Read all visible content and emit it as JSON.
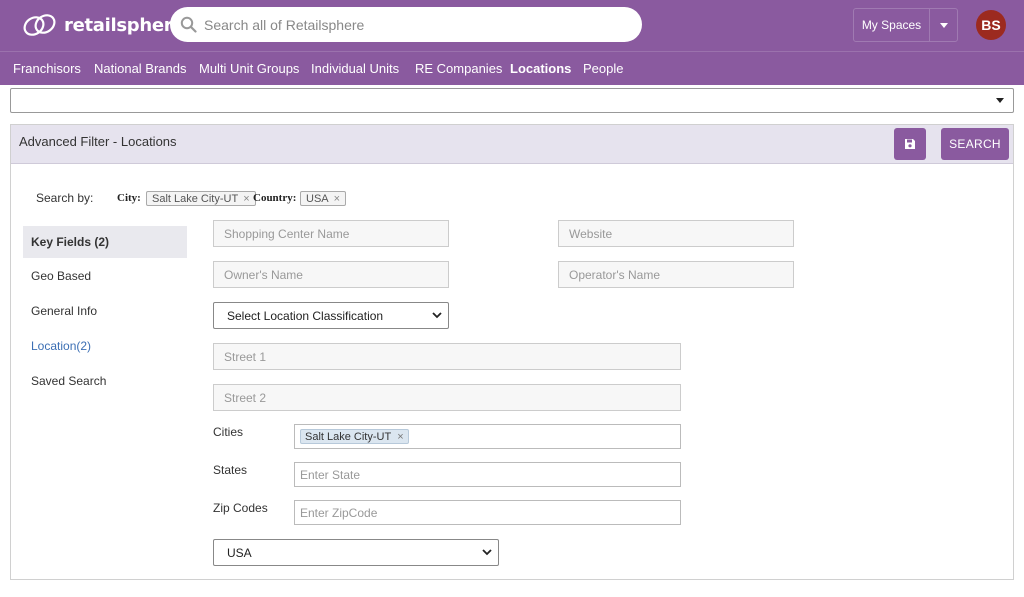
{
  "header": {
    "brand": "retailsphere",
    "search_placeholder": "Search all of Retailsphere",
    "spaces_label": "My Spaces",
    "avatar_initials": "BS",
    "colors": {
      "primary": "#8a5a9f",
      "avatar": "#9c2a1f",
      "link": "#3c6fb4"
    }
  },
  "nav": {
    "items": [
      {
        "label": "Franchisors",
        "active": false
      },
      {
        "label": "National Brands",
        "active": false
      },
      {
        "label": "Multi Unit Groups",
        "active": false
      },
      {
        "label": "Individual Units",
        "active": false
      },
      {
        "label": "RE Companies",
        "active": false
      },
      {
        "label": "Locations",
        "active": true
      },
      {
        "label": "People",
        "active": false
      }
    ]
  },
  "top_select": {
    "value": ""
  },
  "panel": {
    "title": "Advanced Filter - Locations",
    "save_icon": "floppy-disk-icon",
    "search_label": "SEARCH",
    "search_by_label": "Search by:",
    "criteria": [
      {
        "label": "City:",
        "chip": "Salt Lake City-UT"
      },
      {
        "label": "Country:",
        "chip": "USA"
      }
    ]
  },
  "sidebar": {
    "items": [
      {
        "label": "Key Fields (2)",
        "state": "active"
      },
      {
        "label": "Geo Based",
        "state": "normal"
      },
      {
        "label": "General Info",
        "state": "normal"
      },
      {
        "label": "Location(2)",
        "state": "link"
      },
      {
        "label": "Saved Search",
        "state": "normal"
      }
    ]
  },
  "form": {
    "shopping_center_placeholder": "Shopping Center Name",
    "website_placeholder": "Website",
    "owner_placeholder": "Owner's Name",
    "operator_placeholder": "Operator's Name",
    "classification_value": "Select Location Classification",
    "street1_placeholder": "Street 1",
    "street2_placeholder": "Street 2",
    "cities_label": "Cities",
    "cities_tag": "Salt Lake City-UT",
    "states_label": "States",
    "states_placeholder": "Enter State",
    "zip_label": "Zip Codes",
    "zip_placeholder": "Enter ZipCode",
    "country_value": "USA"
  }
}
